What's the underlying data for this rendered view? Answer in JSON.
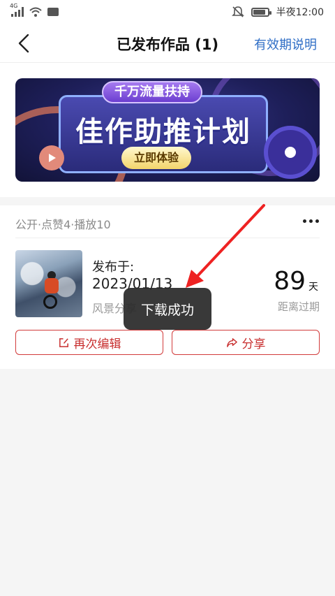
{
  "status_bar": {
    "network_type": "4G",
    "time": "半夜12:00",
    "battery_level": 0.85
  },
  "header": {
    "title": "已发布作品 (1)",
    "right_link": "有效期说明"
  },
  "banner": {
    "tag": "千万流量扶持",
    "headline": "佳作助推计划",
    "cta": "立即体验"
  },
  "work": {
    "meta": "公开·点赞4·播放10",
    "published_label": "发布于:",
    "published_date": "2023/01/13",
    "category": "风景分享",
    "days_remaining": "89",
    "days_unit": "天",
    "days_caption": "距离过期",
    "edit_label": "再次编辑",
    "share_label": "分享"
  },
  "toast": {
    "message": "下载成功"
  },
  "colors": {
    "accent_blue": "#2f6ec6",
    "accent_red": "#c82f2f",
    "annotation_arrow": "#ee2222"
  },
  "icons": [
    "back-chevron-icon",
    "more-dots-icon",
    "edit-icon",
    "share-icon",
    "signal-icon",
    "wifi-icon",
    "mute-bell-icon",
    "battery-icon"
  ]
}
